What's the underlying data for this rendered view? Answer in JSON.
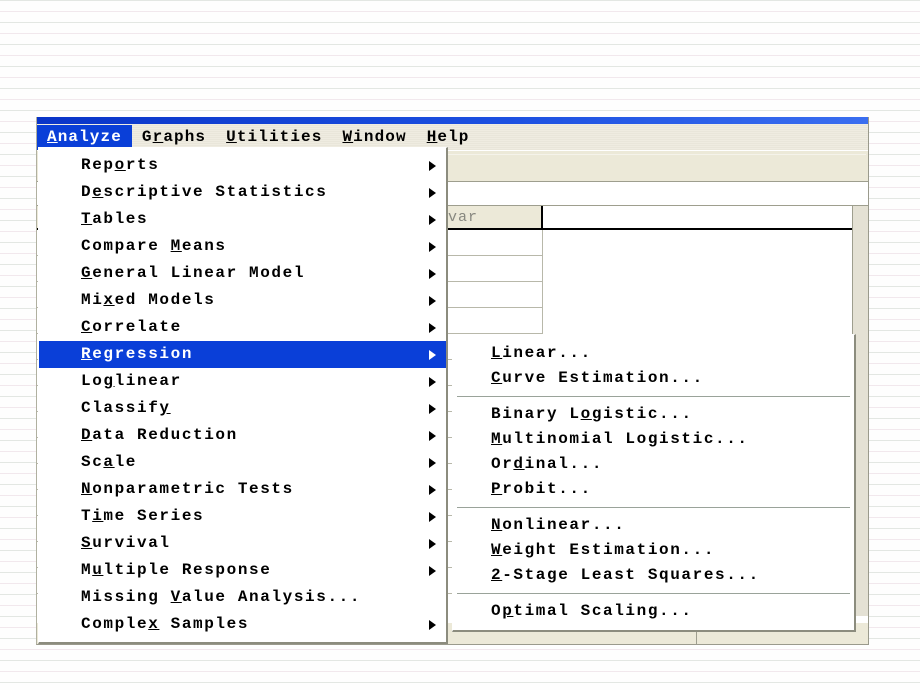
{
  "window": {
    "menubar": [
      {
        "label": "Analyze",
        "mnemonic_index": 0,
        "active": true
      },
      {
        "label": "Graphs",
        "mnemonic_index": 1,
        "active": false
      },
      {
        "label": "Utilities",
        "mnemonic_index": 0,
        "active": false
      },
      {
        "label": "Window",
        "mnemonic_index": 0,
        "active": false
      },
      {
        "label": "Help",
        "mnemonic_index": 0,
        "active": false
      }
    ],
    "toolbar": {
      "icons": [
        "open-file-icon"
      ]
    },
    "grid": {
      "column_headers": [
        "var",
        "var",
        "var"
      ],
      "row_count": 14
    }
  },
  "analyze_menu": {
    "items": [
      {
        "label": "Reports",
        "mnemonic_index": 3,
        "submenu": true,
        "selected": false
      },
      {
        "label": "Descriptive Statistics",
        "mnemonic_index": 1,
        "submenu": true,
        "selected": false
      },
      {
        "label": "Tables",
        "mnemonic_index": 0,
        "submenu": true,
        "selected": false
      },
      {
        "label": "Compare Means",
        "mnemonic_index": 8,
        "submenu": true,
        "selected": false
      },
      {
        "label": "General Linear Model",
        "mnemonic_index": 0,
        "submenu": true,
        "selected": false
      },
      {
        "label": "Mixed Models",
        "mnemonic_index": 2,
        "submenu": true,
        "selected": false
      },
      {
        "label": "Correlate",
        "mnemonic_index": 0,
        "submenu": true,
        "selected": false
      },
      {
        "label": "Regression",
        "mnemonic_index": 0,
        "submenu": true,
        "selected": true
      },
      {
        "label": "Loglinear",
        "mnemonic_index": 2,
        "submenu": true,
        "selected": false
      },
      {
        "label": "Classify",
        "mnemonic_index": 7,
        "submenu": true,
        "selected": false
      },
      {
        "label": "Data Reduction",
        "mnemonic_index": 0,
        "submenu": true,
        "selected": false
      },
      {
        "label": "Scale",
        "mnemonic_index": 2,
        "submenu": true,
        "selected": false
      },
      {
        "label": "Nonparametric Tests",
        "mnemonic_index": 0,
        "submenu": true,
        "selected": false
      },
      {
        "label": "Time Series",
        "mnemonic_index": 1,
        "submenu": true,
        "selected": false
      },
      {
        "label": "Survival",
        "mnemonic_index": 0,
        "submenu": true,
        "selected": false
      },
      {
        "label": "Multiple Response",
        "mnemonic_index": 1,
        "submenu": true,
        "selected": false
      },
      {
        "label": "Missing Value Analysis...",
        "mnemonic_index": 8,
        "submenu": false,
        "selected": false
      },
      {
        "label": "Complex Samples",
        "mnemonic_index": 6,
        "submenu": true,
        "selected": false
      }
    ]
  },
  "regression_submenu": {
    "groups": [
      [
        {
          "label": "Linear...",
          "mnemonic_index": 0
        },
        {
          "label": "Curve Estimation...",
          "mnemonic_index": 0
        }
      ],
      [
        {
          "label": "Binary Logistic...",
          "mnemonic_index": 8
        },
        {
          "label": "Multinomial Logistic...",
          "mnemonic_index": 0
        },
        {
          "label": "Ordinal...",
          "mnemonic_index": 2
        },
        {
          "label": "Probit...",
          "mnemonic_index": 0
        }
      ],
      [
        {
          "label": "Nonlinear...",
          "mnemonic_index": 0
        },
        {
          "label": "Weight Estimation...",
          "mnemonic_index": 0
        },
        {
          "label": "2-Stage Least Squares...",
          "mnemonic_index": 0
        }
      ],
      [
        {
          "label": "Optimal Scaling...",
          "mnemonic_index": 1
        }
      ]
    ]
  },
  "colors": {
    "menu_highlight": "#0a3fd8",
    "menu_face": "#ece9d8",
    "menu_background": "#ffffff",
    "title_bar": "#0a35c8",
    "grid_header_text": "#888880",
    "separator": "#9aa39a"
  }
}
